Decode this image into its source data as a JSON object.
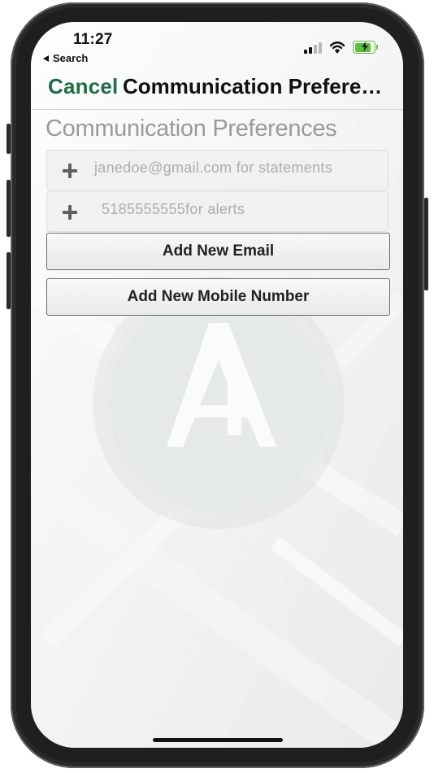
{
  "status_bar": {
    "time": "11:27",
    "back_label": "Search",
    "signal_bars_active": 2,
    "battery_level_percent": 85,
    "battery_color": "#5bc236"
  },
  "navbar": {
    "cancel_label": "Cancel",
    "title": "Communication Preferences",
    "accent_color": "#1e6d43"
  },
  "content": {
    "section_title": "Communication Preferences",
    "preferences": [
      {
        "icon": "plus-icon",
        "value": "janedoe@gmail.com for statements"
      },
      {
        "icon": "plus-icon",
        "value": "5185555555for alerts"
      }
    ],
    "buttons": {
      "add_email": "Add New Email",
      "add_mobile": "Add New Mobile Number"
    }
  },
  "icons": {
    "back": "chevron-left-icon",
    "signal": "cellular-signal-icon",
    "wifi": "wifi-icon",
    "battery": "battery-charging-icon",
    "watermark": "app-logo-watermark"
  }
}
